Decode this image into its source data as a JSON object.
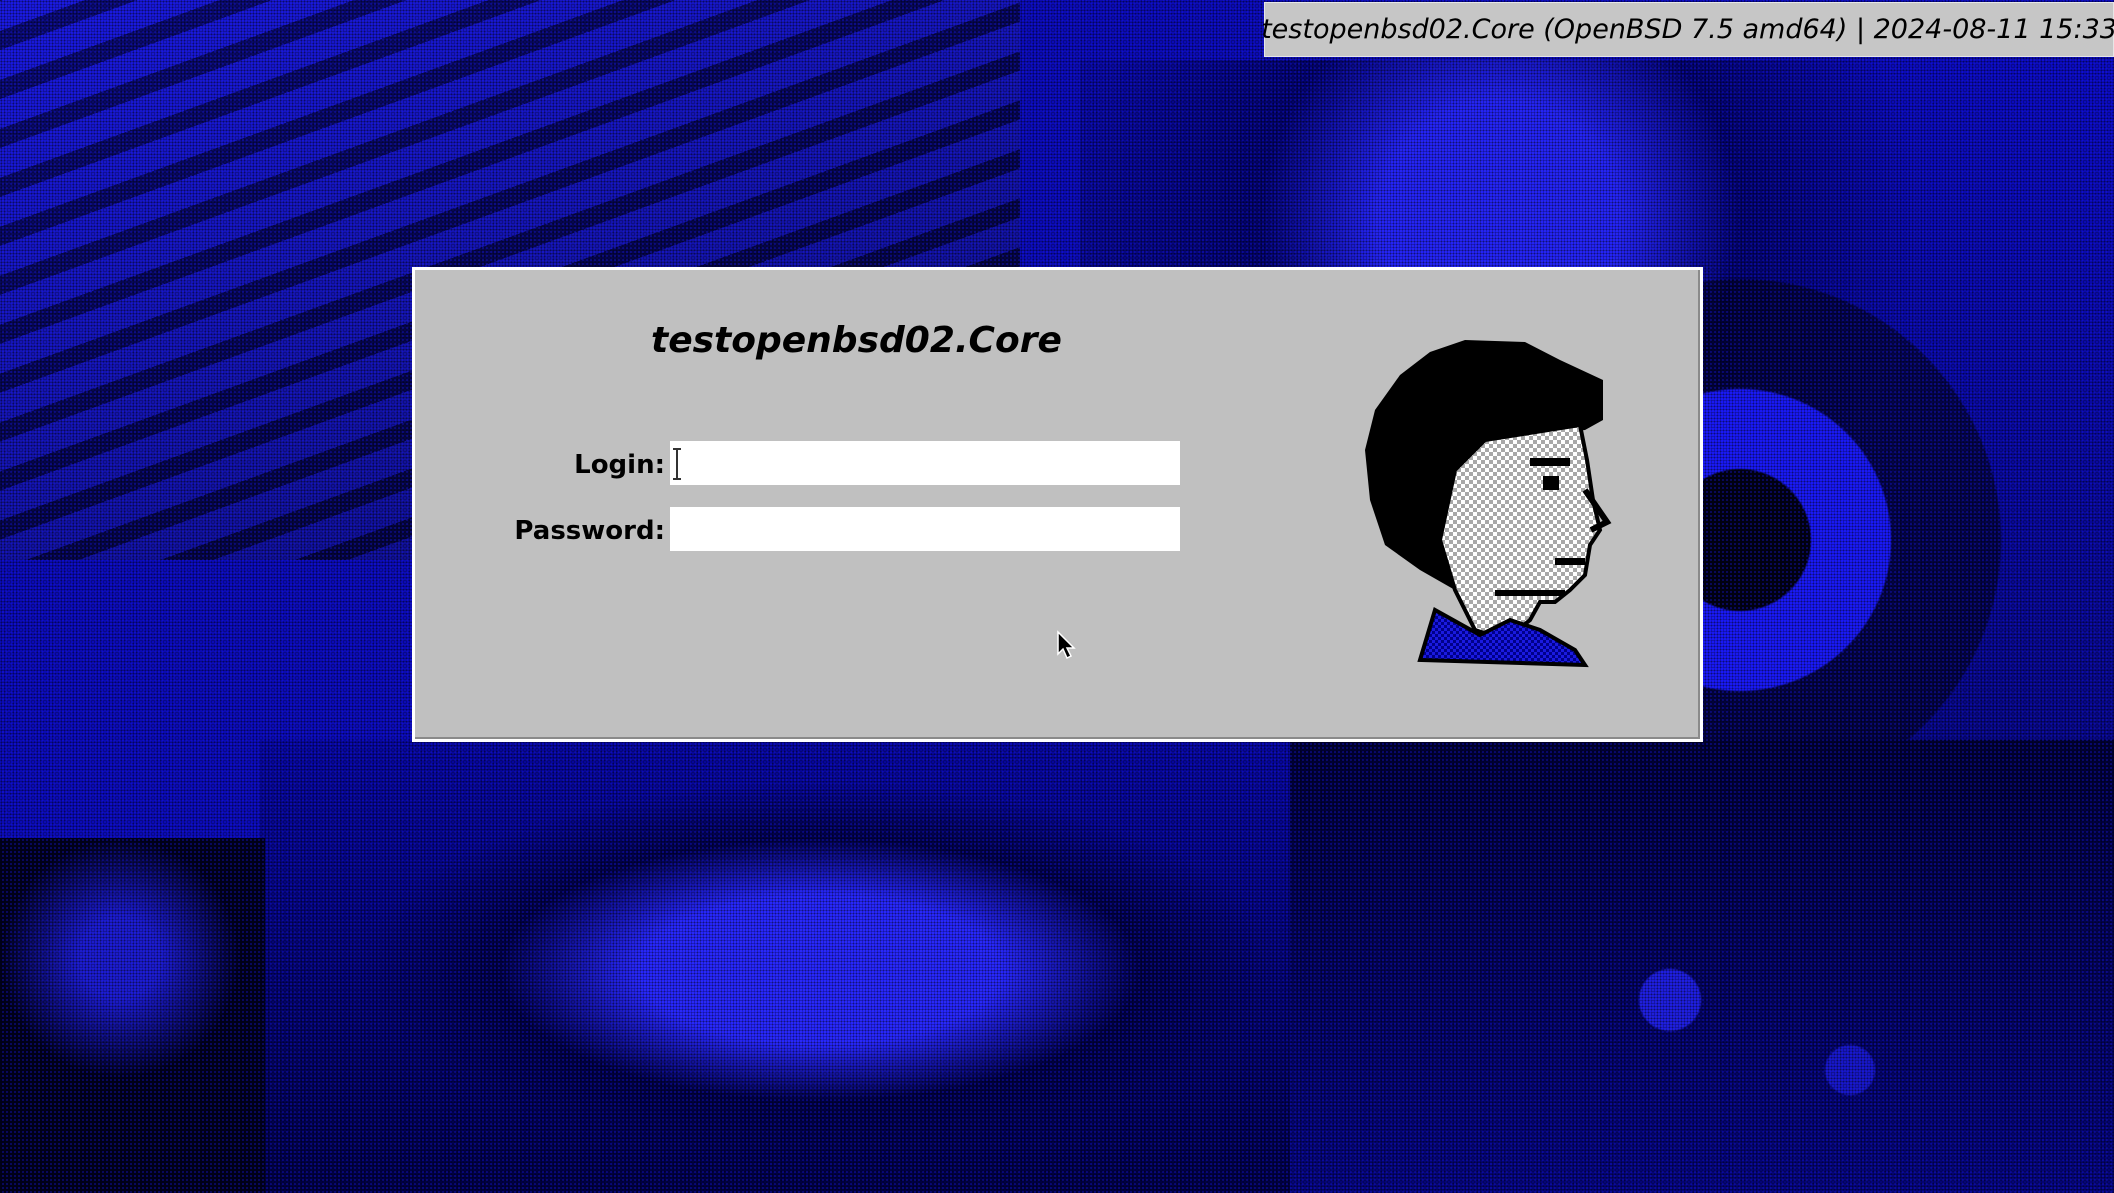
{
  "statusbar": {
    "text": "testopenbsd02.Core (OpenBSD 7.5 amd64) | 2024-08-11 15:33"
  },
  "login_dialog": {
    "hostname": "testopenbsd02.Core",
    "login_label": "Login:",
    "login_value": "",
    "password_label": "Password:",
    "password_value": ""
  },
  "colors": {
    "desktop_blue": "#0b0bb8",
    "dialog_gray": "#c0c0c0",
    "statusbar_gray": "#c6c6c6"
  },
  "icons": {
    "avatar": "puffy-face-icon",
    "pointer": "mouse-pointer-icon",
    "text_caret": "text-cursor-icon"
  }
}
